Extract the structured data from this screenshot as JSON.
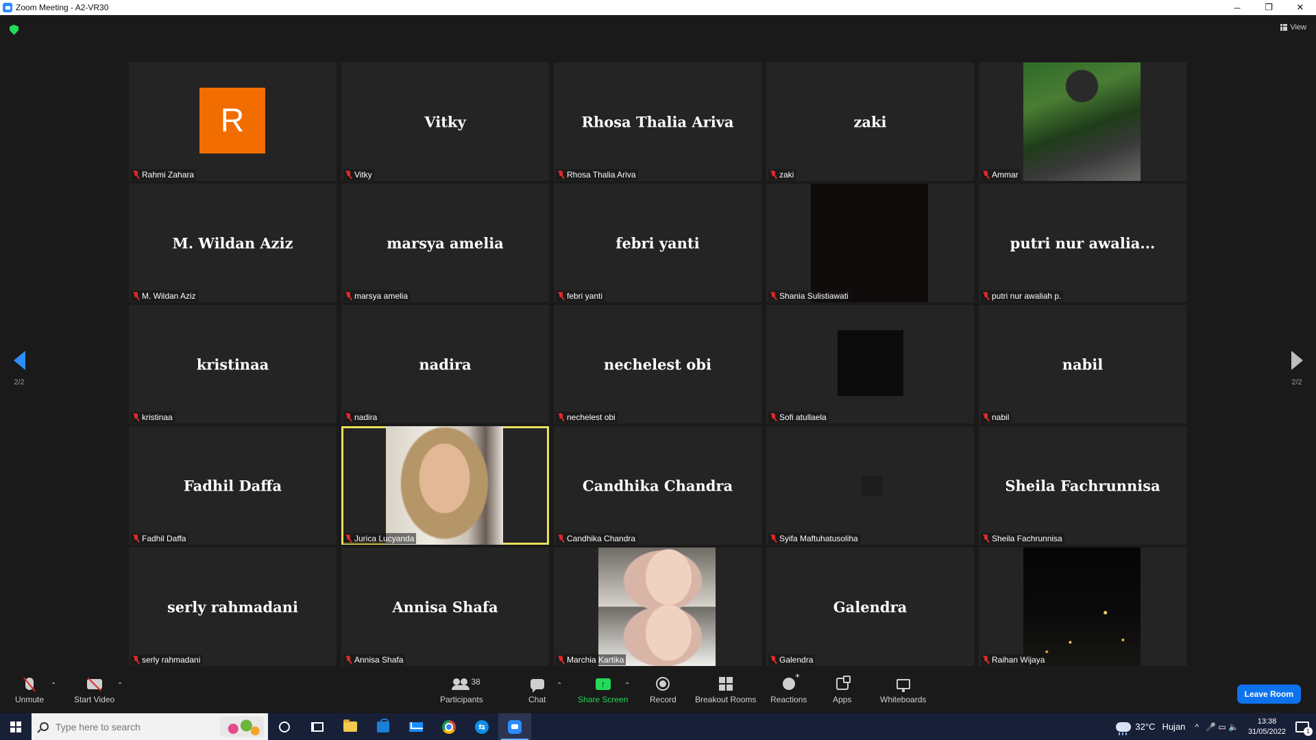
{
  "window": {
    "title": "Zoom Meeting - A2-VR30",
    "minimize": "─",
    "restore": "❐",
    "close": "✕"
  },
  "meeting": {
    "view_label": "View",
    "page_indicator": "2/2",
    "colors": {
      "accent": "#2d8cff",
      "active_speaker_border": "#e8e35a",
      "avatar_orange": "#f26d00",
      "muted_red": "#e02828",
      "share_green": "#23d959"
    },
    "participants": [
      {
        "label": "Rahmi Zahara",
        "display": "",
        "avatar_letter": "R",
        "muted": true
      },
      {
        "label": "Vitky",
        "display": "Vitky",
        "muted": true
      },
      {
        "label": "Rhosa Thalia Ariva",
        "display": "Rhosa Thalia Ariva",
        "muted": true
      },
      {
        "label": "zaki",
        "display": "zaki",
        "muted": true
      },
      {
        "label": "Ammar",
        "display": "",
        "video": "motorcycle-rider",
        "muted": true
      },
      {
        "label": "M. Wildan Aziz",
        "display": "M. Wildan Aziz",
        "muted": true
      },
      {
        "label": "marsya amelia",
        "display": "marsya amelia",
        "muted": true
      },
      {
        "label": "febri yanti",
        "display": "febri yanti",
        "muted": true
      },
      {
        "label": "Shania Sulistiawati",
        "display": "",
        "video": "dark",
        "muted": true
      },
      {
        "label": "putri nur awaliah p.",
        "display": "putri nur awalia...",
        "muted": true
      },
      {
        "label": "kristinaa",
        "display": "kristinaa",
        "muted": true
      },
      {
        "label": "nadira",
        "display": "nadira",
        "muted": true
      },
      {
        "label": "nechelest obi",
        "display": "nechelest obi",
        "muted": true
      },
      {
        "label": "Sofi atullaela",
        "display": "",
        "video": "black-square",
        "muted": true
      },
      {
        "label": "nabil",
        "display": "nabil",
        "muted": true
      },
      {
        "label": "Fadhil Daffa",
        "display": "Fadhil Daffa",
        "muted": true
      },
      {
        "label": "Jurica Lucyanda",
        "display": "",
        "video": "woman-hijab",
        "muted": true,
        "active_speaker": true
      },
      {
        "label": "Candhika Chandra",
        "display": "Candhika Chandra",
        "muted": true
      },
      {
        "label": "Syifa Maftuhatusoliha",
        "display": "",
        "video": "tiny-square",
        "muted": true
      },
      {
        "label": "Sheila Fachrunnisa",
        "display": "Sheila Fachrunnisa",
        "muted": true
      },
      {
        "label": "serly rahmadani",
        "display": "serly rahmadani",
        "muted": true
      },
      {
        "label": "Annisa Shafa",
        "display": "Annisa Shafa",
        "muted": true
      },
      {
        "label": "Marchia Kartika",
        "display": "",
        "video": "selfie-photo",
        "muted": true
      },
      {
        "label": "Galendra",
        "display": "Galendra",
        "muted": true
      },
      {
        "label": "Raihan Wijaya",
        "display": "",
        "video": "night-city",
        "muted": true
      }
    ]
  },
  "toolbar": {
    "unmute": "Unmute",
    "start_video": "Start Video",
    "participants": "Participants",
    "participants_count": "38",
    "chat": "Chat",
    "share_screen": "Share Screen",
    "record": "Record",
    "breakout_rooms": "Breakout Rooms",
    "reactions": "Reactions",
    "apps": "Apps",
    "whiteboards": "Whiteboards",
    "leave": "Leave Room",
    "caret": "⌃"
  },
  "taskbar": {
    "search_placeholder": "Type here to search",
    "teamviewer_glyph": "⇆",
    "temperature": "32°C",
    "weather": "Hujan",
    "chevron": "^",
    "tray_icons": "🎤 ▭ 🔈",
    "time": "13:38",
    "date": "31/05/2022",
    "notifications": "1"
  }
}
